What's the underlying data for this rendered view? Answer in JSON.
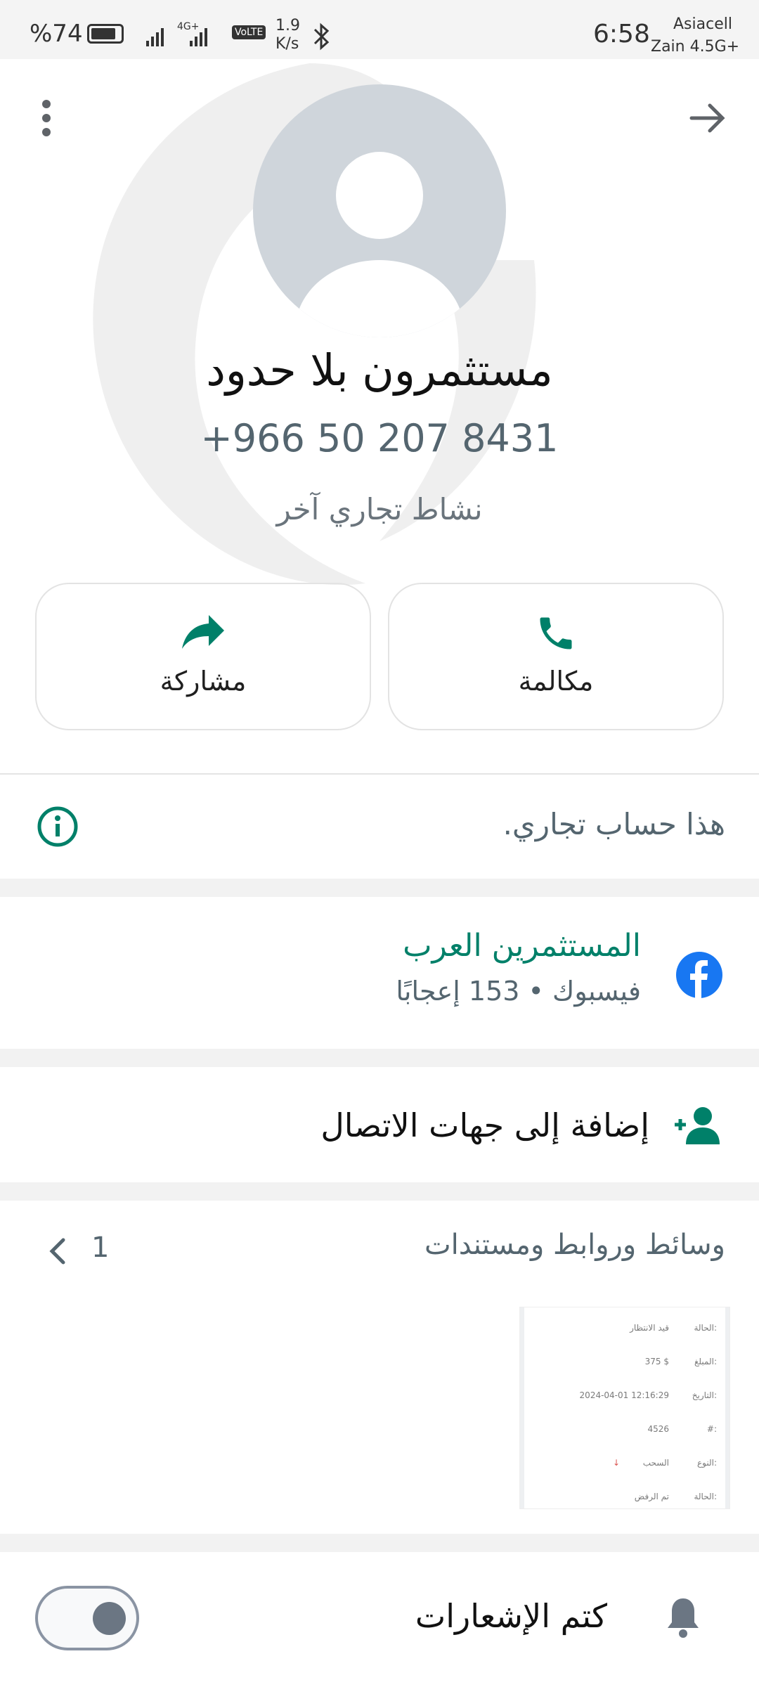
{
  "status_bar": {
    "battery": "%74",
    "network_speed_value": "1.9",
    "network_speed_unit": "K/s",
    "volte": "VoLTE",
    "signal_4g": "4G+",
    "time": "6:58",
    "carrier1": "Asiacell",
    "carrier2": "Zain 4.5G+"
  },
  "header": {
    "back_icon": "arrow-right-icon",
    "menu_icon": "more-vert-icon"
  },
  "profile": {
    "name": "مستثمرون بلا حدود",
    "phone": "+966 50 207 8431",
    "category": "نشاط تجاري آخر"
  },
  "actions": {
    "call_label": "مكالمة",
    "share_label": "مشاركة"
  },
  "business_notice": "هذا حساب تجاري.",
  "facebook": {
    "page_name": "المستثمرين العرب",
    "source": "فيسبوك",
    "separator": "•",
    "likes": "153 إعجابًا"
  },
  "add_contact_label": "إضافة إلى جهات الاتصال",
  "media": {
    "title": "وسائط وروابط ومستندات",
    "count": "1"
  },
  "document_preview": {
    "rows": [
      {
        "key": "الحالة:",
        "value": "قيد الانتظار"
      },
      {
        "key": "المبلغ:",
        "value": "375 $"
      },
      {
        "key": "التاريخ:",
        "value": "2024-04-01 12:16:29"
      },
      {
        "key": "#:",
        "value": "4526"
      },
      {
        "key": "النوع:",
        "value": "السحب"
      },
      {
        "key": "الحالة:",
        "value": "تم الرفض"
      }
    ]
  },
  "mute": {
    "label": "كتم الإشعارات",
    "enabled": false
  },
  "colors": {
    "accent": "#008069",
    "facebook": "#1877f2",
    "text_secondary": "#54656f"
  }
}
